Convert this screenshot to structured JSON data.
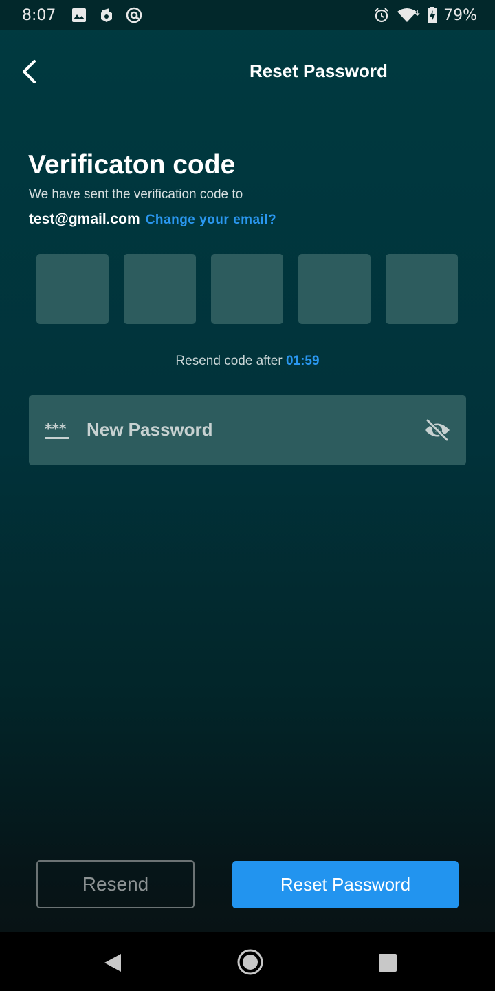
{
  "status_bar": {
    "time": "8:07",
    "battery": "79%",
    "icons_left": [
      "image-icon",
      "music-app-icon",
      "at-sign-icon"
    ],
    "icons_right": [
      "alarm-icon",
      "wifi-icon",
      "battery-charging-icon"
    ]
  },
  "header": {
    "title": "Reset Password",
    "back_icon": "chevron-left-icon"
  },
  "content": {
    "heading": "Verificaton code",
    "subtitle": "We have sent the verification code to",
    "email": "test@gmail.com",
    "change_email": "Change your email?",
    "otp_boxes": [
      "",
      "",
      "",
      "",
      ""
    ],
    "resend_prefix": "Resend code after",
    "timer": "01:59"
  },
  "password_field": {
    "placeholder": "New Password",
    "leading_icon": "password-dots-icon",
    "trailing_icon": "eye-off-icon"
  },
  "buttons": {
    "resend": "Resend",
    "reset": "Reset Password"
  },
  "colors": {
    "accent": "#2294ef",
    "field_bg": "#2d5c5e",
    "bg_top": "#003a40"
  },
  "nav_bar": {
    "icons": [
      "nav-back-icon",
      "nav-home-icon",
      "nav-recents-icon"
    ]
  }
}
